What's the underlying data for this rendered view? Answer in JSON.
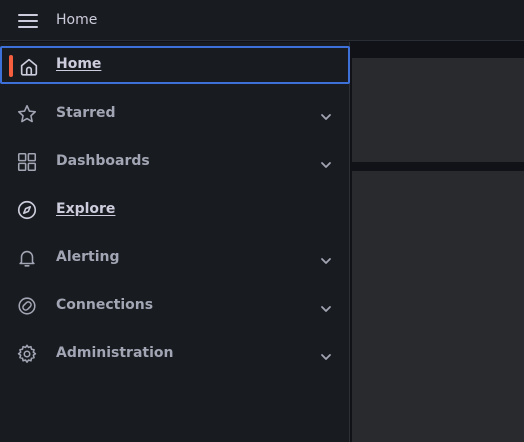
{
  "header": {
    "title": "Home",
    "menu_icon": "hamburger-menu-icon"
  },
  "sidebar": {
    "items": [
      {
        "label": "Home",
        "icon": "home-icon",
        "active": true,
        "expandable": false
      },
      {
        "label": "Starred",
        "icon": "star-icon",
        "active": false,
        "expandable": true
      },
      {
        "label": "Dashboards",
        "icon": "apps-grid-icon",
        "active": false,
        "expandable": true
      },
      {
        "label": "Explore",
        "icon": "compass-icon",
        "active": false,
        "expandable": false
      },
      {
        "label": "Alerting",
        "icon": "bell-icon",
        "active": false,
        "expandable": true
      },
      {
        "label": "Connections",
        "icon": "connections-icon",
        "active": false,
        "expandable": true
      },
      {
        "label": "Administration",
        "icon": "gear-icon",
        "active": false,
        "expandable": true
      }
    ]
  },
  "colors": {
    "active_indicator": "#f55f3e",
    "focus_border": "#3d71d9",
    "sidebar_bg": "#181b1f",
    "panel_bg": "#292a2e"
  }
}
